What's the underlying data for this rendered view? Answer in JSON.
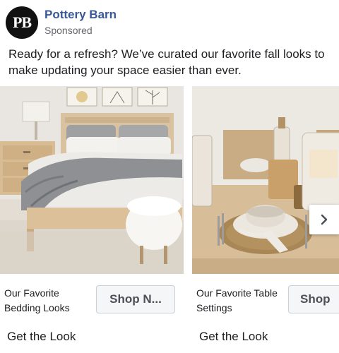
{
  "page": {
    "name": "Pottery Barn",
    "sponsored": "Sponsored",
    "avatar_text": "PB"
  },
  "post": {
    "caption": "Ready for a refresh? We’ve curated our favorite fall looks to make updating your space easier than ever."
  },
  "cards": [
    {
      "title": "Our Favorite Bedding Looks",
      "cta": "Shop N...",
      "link": "Get the Look"
    },
    {
      "title": "Our Favorite Table Settings",
      "cta": "Shop",
      "link": "Get the Look"
    }
  ],
  "icons": {
    "next": "chevron-right-icon"
  },
  "colors": {
    "page_name": "#385898",
    "muted": "#65676b"
  }
}
